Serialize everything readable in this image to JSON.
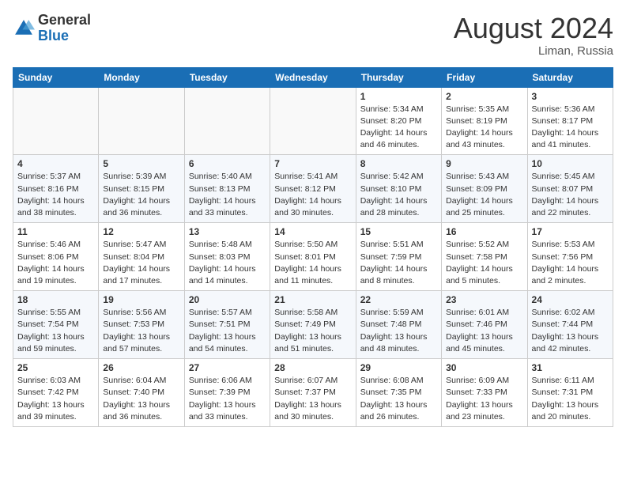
{
  "header": {
    "logo_general": "General",
    "logo_blue": "Blue",
    "month_year": "August 2024",
    "location": "Liman, Russia"
  },
  "days_of_week": [
    "Sunday",
    "Monday",
    "Tuesday",
    "Wednesday",
    "Thursday",
    "Friday",
    "Saturday"
  ],
  "weeks": [
    [
      {
        "day": "",
        "info": ""
      },
      {
        "day": "",
        "info": ""
      },
      {
        "day": "",
        "info": ""
      },
      {
        "day": "",
        "info": ""
      },
      {
        "day": "1",
        "info": "Sunrise: 5:34 AM\nSunset: 8:20 PM\nDaylight: 14 hours\nand 46 minutes."
      },
      {
        "day": "2",
        "info": "Sunrise: 5:35 AM\nSunset: 8:19 PM\nDaylight: 14 hours\nand 43 minutes."
      },
      {
        "day": "3",
        "info": "Sunrise: 5:36 AM\nSunset: 8:17 PM\nDaylight: 14 hours\nand 41 minutes."
      }
    ],
    [
      {
        "day": "4",
        "info": "Sunrise: 5:37 AM\nSunset: 8:16 PM\nDaylight: 14 hours\nand 38 minutes."
      },
      {
        "day": "5",
        "info": "Sunrise: 5:39 AM\nSunset: 8:15 PM\nDaylight: 14 hours\nand 36 minutes."
      },
      {
        "day": "6",
        "info": "Sunrise: 5:40 AM\nSunset: 8:13 PM\nDaylight: 14 hours\nand 33 minutes."
      },
      {
        "day": "7",
        "info": "Sunrise: 5:41 AM\nSunset: 8:12 PM\nDaylight: 14 hours\nand 30 minutes."
      },
      {
        "day": "8",
        "info": "Sunrise: 5:42 AM\nSunset: 8:10 PM\nDaylight: 14 hours\nand 28 minutes."
      },
      {
        "day": "9",
        "info": "Sunrise: 5:43 AM\nSunset: 8:09 PM\nDaylight: 14 hours\nand 25 minutes."
      },
      {
        "day": "10",
        "info": "Sunrise: 5:45 AM\nSunset: 8:07 PM\nDaylight: 14 hours\nand 22 minutes."
      }
    ],
    [
      {
        "day": "11",
        "info": "Sunrise: 5:46 AM\nSunset: 8:06 PM\nDaylight: 14 hours\nand 19 minutes."
      },
      {
        "day": "12",
        "info": "Sunrise: 5:47 AM\nSunset: 8:04 PM\nDaylight: 14 hours\nand 17 minutes."
      },
      {
        "day": "13",
        "info": "Sunrise: 5:48 AM\nSunset: 8:03 PM\nDaylight: 14 hours\nand 14 minutes."
      },
      {
        "day": "14",
        "info": "Sunrise: 5:50 AM\nSunset: 8:01 PM\nDaylight: 14 hours\nand 11 minutes."
      },
      {
        "day": "15",
        "info": "Sunrise: 5:51 AM\nSunset: 7:59 PM\nDaylight: 14 hours\nand 8 minutes."
      },
      {
        "day": "16",
        "info": "Sunrise: 5:52 AM\nSunset: 7:58 PM\nDaylight: 14 hours\nand 5 minutes."
      },
      {
        "day": "17",
        "info": "Sunrise: 5:53 AM\nSunset: 7:56 PM\nDaylight: 14 hours\nand 2 minutes."
      }
    ],
    [
      {
        "day": "18",
        "info": "Sunrise: 5:55 AM\nSunset: 7:54 PM\nDaylight: 13 hours\nand 59 minutes."
      },
      {
        "day": "19",
        "info": "Sunrise: 5:56 AM\nSunset: 7:53 PM\nDaylight: 13 hours\nand 57 minutes."
      },
      {
        "day": "20",
        "info": "Sunrise: 5:57 AM\nSunset: 7:51 PM\nDaylight: 13 hours\nand 54 minutes."
      },
      {
        "day": "21",
        "info": "Sunrise: 5:58 AM\nSunset: 7:49 PM\nDaylight: 13 hours\nand 51 minutes."
      },
      {
        "day": "22",
        "info": "Sunrise: 5:59 AM\nSunset: 7:48 PM\nDaylight: 13 hours\nand 48 minutes."
      },
      {
        "day": "23",
        "info": "Sunrise: 6:01 AM\nSunset: 7:46 PM\nDaylight: 13 hours\nand 45 minutes."
      },
      {
        "day": "24",
        "info": "Sunrise: 6:02 AM\nSunset: 7:44 PM\nDaylight: 13 hours\nand 42 minutes."
      }
    ],
    [
      {
        "day": "25",
        "info": "Sunrise: 6:03 AM\nSunset: 7:42 PM\nDaylight: 13 hours\nand 39 minutes."
      },
      {
        "day": "26",
        "info": "Sunrise: 6:04 AM\nSunset: 7:40 PM\nDaylight: 13 hours\nand 36 minutes."
      },
      {
        "day": "27",
        "info": "Sunrise: 6:06 AM\nSunset: 7:39 PM\nDaylight: 13 hours\nand 33 minutes."
      },
      {
        "day": "28",
        "info": "Sunrise: 6:07 AM\nSunset: 7:37 PM\nDaylight: 13 hours\nand 30 minutes."
      },
      {
        "day": "29",
        "info": "Sunrise: 6:08 AM\nSunset: 7:35 PM\nDaylight: 13 hours\nand 26 minutes."
      },
      {
        "day": "30",
        "info": "Sunrise: 6:09 AM\nSunset: 7:33 PM\nDaylight: 13 hours\nand 23 minutes."
      },
      {
        "day": "31",
        "info": "Sunrise: 6:11 AM\nSunset: 7:31 PM\nDaylight: 13 hours\nand 20 minutes."
      }
    ]
  ]
}
